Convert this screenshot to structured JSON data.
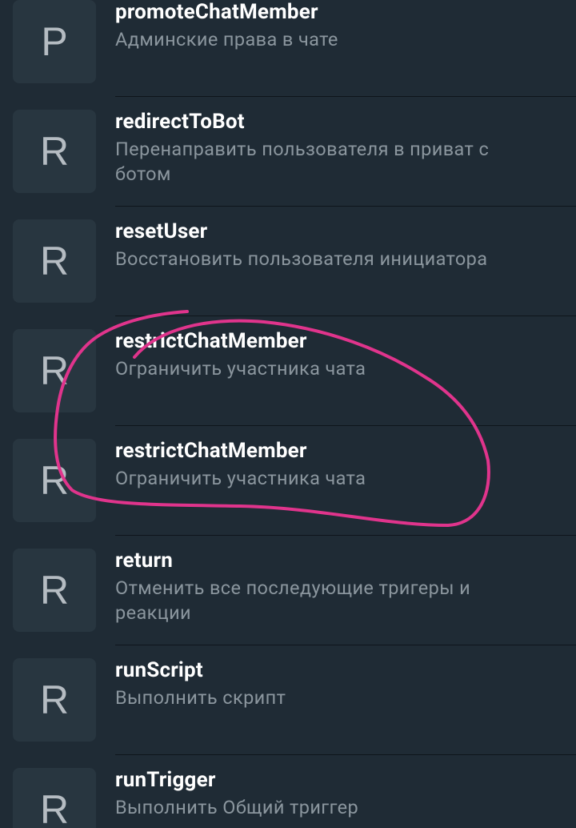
{
  "colors": {
    "background": "#1f2b35",
    "avatar_background": "#283640",
    "title": "#ffffff",
    "subtitle": "#8b969e",
    "annotation": "#e0348c"
  },
  "items": [
    {
      "letter": "P",
      "title": "promoteChatMember",
      "subtitle": "Админские права в чате"
    },
    {
      "letter": "R",
      "title": "redirectToBot",
      "subtitle": "Перенаправить пользователя в приват с ботом"
    },
    {
      "letter": "R",
      "title": "resetUser",
      "subtitle": "Восстановить пользователя инициатора"
    },
    {
      "letter": "R",
      "title": "restrictChatMember",
      "subtitle": "Ограничить участника чата"
    },
    {
      "letter": "R",
      "title": "restrictChatMember",
      "subtitle": "Ограничить участника чата"
    },
    {
      "letter": "R",
      "title": "return",
      "subtitle": "Отменить все последующие тригеры и реакции"
    },
    {
      "letter": "R",
      "title": "runScript",
      "subtitle": "Выполнить скрипт"
    },
    {
      "letter": "R",
      "title": "runTrigger",
      "subtitle": "Выполнить Общий триггер"
    }
  ]
}
